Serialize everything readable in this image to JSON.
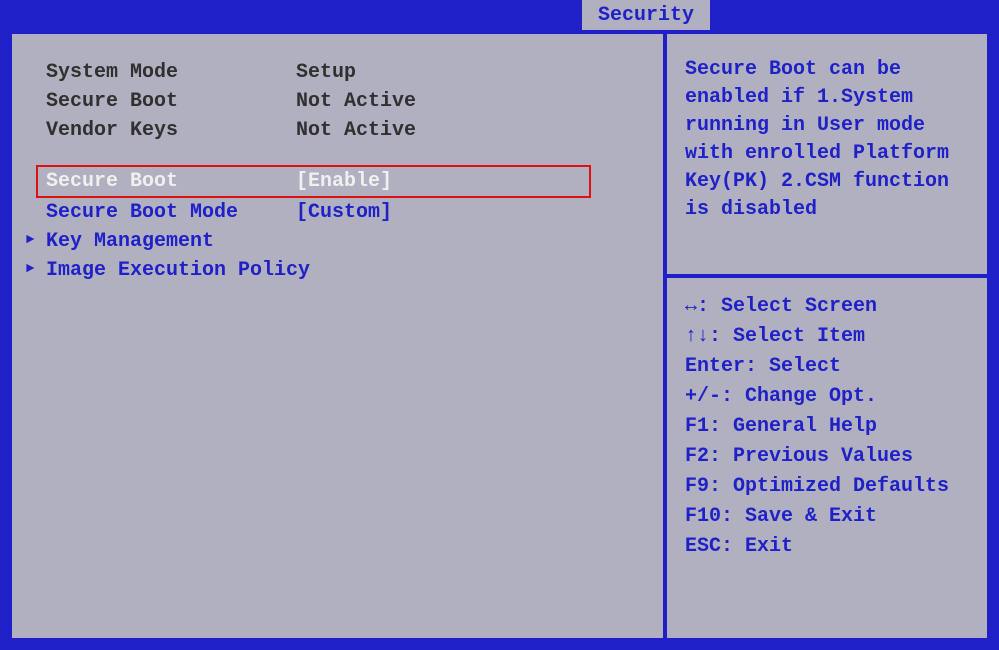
{
  "tab": {
    "label": "Security"
  },
  "status": {
    "system_mode": {
      "label": "System Mode",
      "value": "Setup"
    },
    "secure_boot_status": {
      "label": "Secure Boot",
      "value": "Not Active"
    },
    "vendor_keys": {
      "label": "Vendor Keys",
      "value": "Not Active"
    }
  },
  "settings": {
    "secure_boot": {
      "label": "Secure Boot",
      "value": "[Enable]"
    },
    "secure_boot_mode": {
      "label": "Secure Boot Mode",
      "value": "[Custom]"
    },
    "key_management": {
      "label": "Key Management"
    },
    "image_execution_policy": {
      "label": "Image Execution Policy"
    }
  },
  "help": {
    "description": "Secure Boot can be enabled if 1.System running in User mode with enrolled Platform Key(PK) 2.CSM function is disabled",
    "keys": {
      "select_screen": "↔: Select Screen",
      "select_item": "↑↓: Select Item",
      "enter": "Enter: Select",
      "change": "+/-: Change Opt.",
      "f1": "F1: General Help",
      "f2": "F2: Previous Values",
      "f9": "F9: Optimized Defaults",
      "f10": "F10: Save & Exit",
      "esc": "ESC: Exit"
    }
  }
}
